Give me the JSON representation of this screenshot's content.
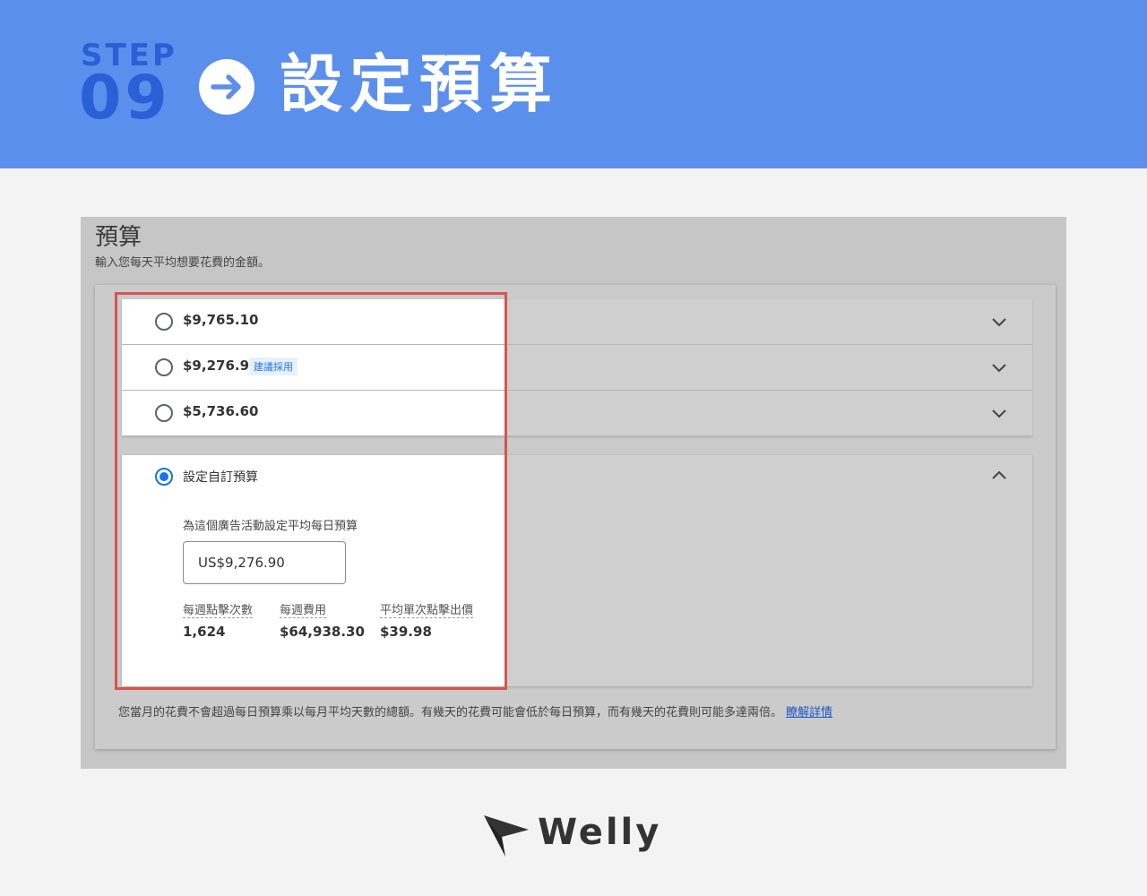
{
  "banner": {
    "step_word": "STEP",
    "step_number": "09",
    "title": "設定預算",
    "arrow_icon": "arrow-right-icon"
  },
  "budget": {
    "heading": "預算",
    "subtitle": "輸入您每天平均想要花費的金額。",
    "options": [
      {
        "price": "$9,765.10",
        "selected": false
      },
      {
        "price": "$9,276.90",
        "selected": false,
        "badge": "建議採用"
      },
      {
        "price": "$5,736.60",
        "selected": false
      }
    ],
    "custom": {
      "label": "設定自訂預算",
      "selected": true,
      "help": "為這個廣告活動設定平均每日預算",
      "input_value": "US$9,276.90",
      "stats": [
        {
          "label": "每週點擊次數",
          "value": "1,624"
        },
        {
          "label": "每週費用",
          "value": "$64,938.30"
        },
        {
          "label": "平均單次點擊出價",
          "value": "$39.98"
        }
      ]
    },
    "footnote": "您當月的花費不會超過每日預算乘以每月平均天數的總額。有幾天的花費可能會低於每日預算，而有幾天的花費則可能多達兩倍。",
    "learn_more": "瞭解詳情"
  },
  "logo": {
    "text": "Welly"
  },
  "colors": {
    "banner": "#5b8fec",
    "step": "#2b5fd6",
    "highlight": "#d9534f",
    "accent": "#1a73e8"
  }
}
